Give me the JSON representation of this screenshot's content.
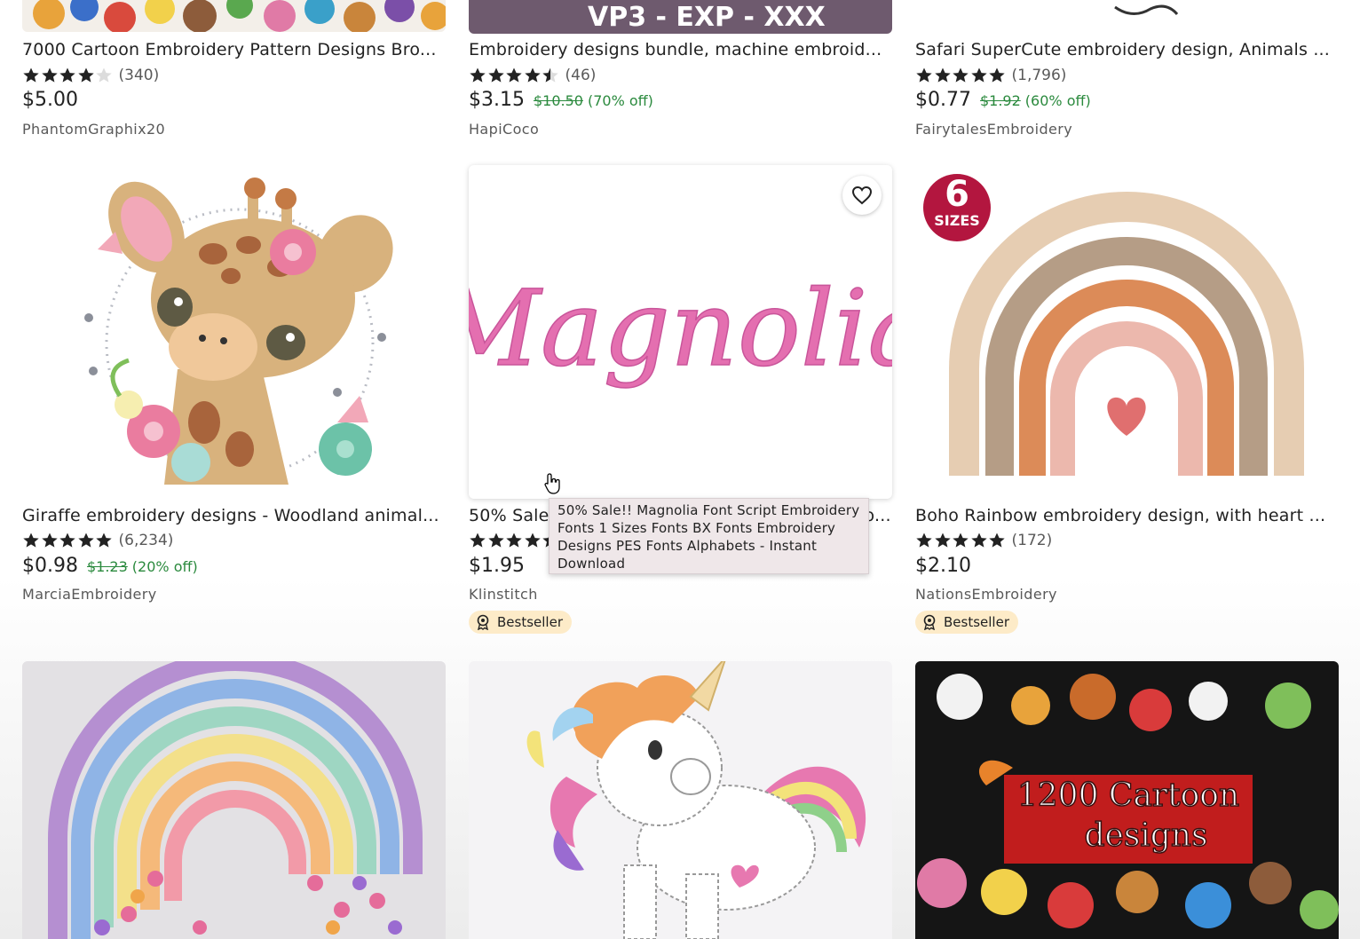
{
  "row1": [
    {
      "title": "7000 Cartoon Embroidery Pattern Designs Bro...",
      "stars": 4,
      "reviews": "(340)",
      "price": "$5.00",
      "shop": "PhantomGraphix20"
    },
    {
      "title": "Embroidery designs bundle, machine embroid...",
      "stars": 4.5,
      "reviews": "(46)",
      "price": "$3.15",
      "orig": "$10.50",
      "off": "(70% off)",
      "shop": "HapiCoco",
      "image_text": "VP3 - EXP - XXX"
    },
    {
      "title": "Safari SuperCute embroidery design, Animals ...",
      "stars": 5,
      "reviews": "(1,796)",
      "price": "$0.77",
      "orig": "$1.92",
      "off": "(60% off)",
      "shop": "FairytalesEmbroidery"
    }
  ],
  "row2": [
    {
      "title": "Giraffe embroidery designs - Woodland animal...",
      "stars": 5,
      "reviews": "(6,234)",
      "price": "$0.98",
      "orig": "$1.23",
      "off": "(20% off)",
      "shop": "MarciaEmbroidery"
    },
    {
      "title": "50% Sale!! Magnolia Font Script Embroidery Fo...",
      "stars": 5,
      "reviews": "",
      "price": "$1.95",
      "shop": "Klinstitch",
      "badge": "Bestseller",
      "image_text": "Magnolia"
    },
    {
      "title": "Boho Rainbow embroidery design, with heart ...",
      "stars": 5,
      "reviews": "(172)",
      "price": "$2.10",
      "shop": "NationsEmbroidery",
      "badge": "Bestseller",
      "sizes_badge": {
        "number": "6",
        "label": "SIZES"
      }
    }
  ],
  "row3": [
    {
      "alt": "rainbow with hearts"
    },
    {
      "alt": "unicorn"
    },
    {
      "alt": "cartoon collage",
      "image_text_1": "1200 Cartoon",
      "image_text_2": "designs"
    }
  ],
  "tooltip": "50% Sale!! Magnolia Font Script Embroidery Fonts 1 Sizes Fonts BX Fonts Embroidery Designs PES Fonts Alphabets - Instant Download",
  "colors": {
    "sale_green": "#2b8a3e",
    "badge_bg": "#fdebc8",
    "text": "#222222",
    "muted": "#595959",
    "sizes_badge": "#b3163f",
    "magnolia_pink": "#e46fb0"
  },
  "icons": {
    "favorite": "heart-outline-icon",
    "bestseller": "award-ribbon-icon",
    "cursor": "hand-pointer-icon"
  }
}
